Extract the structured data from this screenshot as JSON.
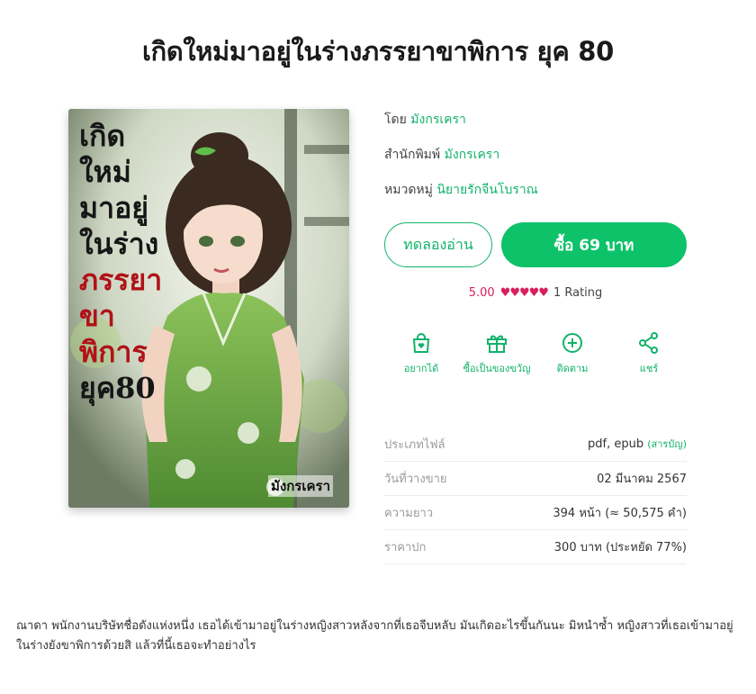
{
  "book": {
    "title": "เกิดใหม่มาอยู่ในร่างภรรยาขาพิการ ยุค 80",
    "cover": {
      "title_lines": [
        "เกิด",
        "ใหม่",
        "มาอยู่",
        "ในร่าง"
      ],
      "title_red_lines": [
        "ภรรยา",
        "ขาพิการ"
      ],
      "title_last_line": "ยุค80",
      "author": "มังกรเครา"
    },
    "author_label": "โดย",
    "author": "มังกรเครา",
    "publisher_label": "สำนักพิมพ์",
    "publisher": "มังกรเครา",
    "category_label": "หมวดหมู่",
    "category": "นิยายรักจีนโบราณ"
  },
  "buttons": {
    "try_read": "ทดลองอ่าน",
    "buy": "ซื้อ 69 บาท"
  },
  "rating": {
    "score": "5.00",
    "hearts": "♥♥♥♥♥",
    "count": "1 Rating"
  },
  "actions": [
    {
      "label": "อยากได้",
      "icon": "wishlist-bag-icon"
    },
    {
      "label": "ซื้อเป็นของขวัญ",
      "icon": "gift-icon"
    },
    {
      "label": "ติดตาม",
      "icon": "plus-circle-icon"
    },
    {
      "label": "แชร์",
      "icon": "share-icon"
    }
  ],
  "info": [
    {
      "key": "ประเภทไฟล์",
      "value": "pdf, epub",
      "extra": "(สารบัญ)"
    },
    {
      "key": "วันที่วางขาย",
      "value": "02 มีนาคม 2567"
    },
    {
      "key": "ความยาว",
      "value": "394 หน้า (≈ 50,575 คำ)"
    },
    {
      "key": "ราคาปก",
      "value": "300 บาท (ประหยัด 77%)"
    }
  ],
  "description": "ณาดา พนักงานบริษัทชื่อดังแห่งหนึ่ง เธอได้เข้ามาอยู่ในร่างหญิงสาวหลังจากที่เธอจีบหลับ มันเกิดอะไรขึ้นกันนะ มิหนำซ้ำ หญิงสาวที่เธอเข้ามาอยู่ในร่างยังขาพิการด้วยสิ แล้วที่นี้เธอจะทำอย่างไร",
  "colors": {
    "accent": "#0ec26a",
    "link": "#11b36a",
    "rating": "#d81e5b"
  }
}
